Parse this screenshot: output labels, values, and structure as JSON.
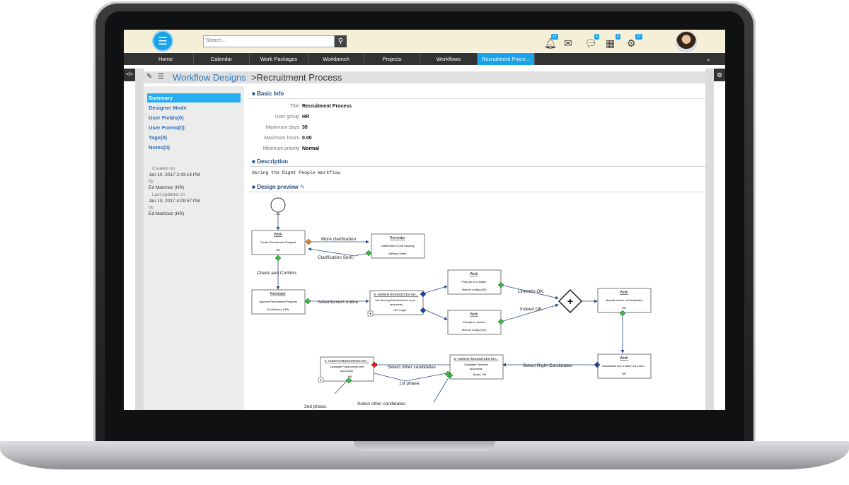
{
  "search": {
    "placeholder": "Search..."
  },
  "notifications": {
    "bell_count": "15",
    "chat_count": "5",
    "calendar_count": "9",
    "settings_count": "27"
  },
  "nav": {
    "tabs": [
      {
        "label": "Home"
      },
      {
        "label": "Calendar"
      },
      {
        "label": "Work Packages"
      },
      {
        "label": "Workbench"
      },
      {
        "label": "Projects"
      },
      {
        "label": "Workflows"
      },
      {
        "label": "Recruitment Proce..."
      }
    ]
  },
  "breadcrumb": {
    "root": "Workflow Designs",
    "current": ">Recruitment Process"
  },
  "sidebar": {
    "items": [
      {
        "label": "Summary"
      },
      {
        "label": "Designer Mode"
      },
      {
        "label": "User Fields(0)"
      },
      {
        "label": "User Forms(0)"
      },
      {
        "label": "Tags(0)"
      },
      {
        "label": "Notes(0)"
      }
    ],
    "created_label": "Created on",
    "created_date": "Jan 10, 2017 2:43:14 PM",
    "by_label": "by",
    "created_by": "Ed Martinez (HR)",
    "updated_label": "Last updated on",
    "updated_date": "Jan 10, 2017 4:09:57 PM",
    "updated_by_label": "by",
    "updated_by": "Ed Martinez (HR)"
  },
  "basic_info": {
    "heading": "Basic Info",
    "fields": [
      {
        "label": "Title",
        "value": "Recruitment Process"
      },
      {
        "label": "User group",
        "value": "HR"
      },
      {
        "label": "Maximum days",
        "value": "30"
      },
      {
        "label": "Maximum hours",
        "value": "0.00"
      },
      {
        "label": "Minimum priority",
        "value": "Normal"
      }
    ]
  },
  "description": {
    "heading": "Description",
    "text": "Hiring the Right People Workflow"
  },
  "design_preview": {
    "heading": "Design preview",
    "start_label": "start",
    "nodes": {
      "work1_title": "Work",
      "work1_desc": "Create Recruitment Request",
      "work1_user": "HR",
      "rem1_title": "Reminder",
      "rem1_desc": "Clarification of job vacancy",
      "rem1_user": "Melissa Smith",
      "rem2_title": "Reminder",
      "rem2_desc": "Approve Recruitment Request",
      "rem2_user": "Ed Martinez (HR)",
      "sub1_title": "5. HUMAN RESOURCES MA...",
      "sub1_desc": "Job Vacancy Advertisement on ya...",
      "sub1_sub": "(subprocess)",
      "sub1_user": "HR, Legal",
      "work2_title": "Work",
      "work2_desc": "Post job in LinkedIn",
      "work2_user": "Simone Leddy (HR)",
      "work3_title": "Work",
      "work3_desc": "Post job in Indeed",
      "work3_user": "Simone Leddy (HR)",
      "work4_title": "Work",
      "work4_desc": "Manual search of Candidates",
      "work4_user": "HR",
      "work5_title": "Work",
      "work5_desc": "Candidates List creation for interv...",
      "work5_user": "HR",
      "sub2_title": "5. HUMAN RESOURCES MA...",
      "sub2_desc": "Candidate Selection",
      "sub2_sub": "(subprocess)",
      "sub2_user": "Board, HR",
      "sub3_title": "5. HUMAN RESOURCES MA...",
      "sub3_desc": "Candidate Psychometric test",
      "sub3_sub": "(subprocess)",
      "sub3_user": "HR"
    },
    "edges": {
      "more_clarification": "More clarification",
      "clarification_sent": "Clarification Sent.",
      "check_confirm": "Check and Confirm.",
      "advertisment_online": "Advertisment online",
      "linkedin_ok": "LinkedIn OK.",
      "indeed_ok": "Indeed OK.",
      "select_right": "Select Right Candidates",
      "select_other_1": "Select other candidates",
      "first_phase": "1st phase.",
      "second_phase": "2nd phase.",
      "select_other_2": "Select other candidates."
    }
  }
}
